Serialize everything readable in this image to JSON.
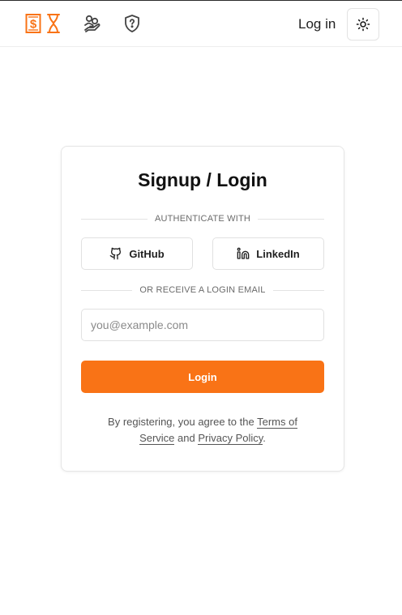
{
  "header": {
    "logo_icon": "dollar-hourglass-icon",
    "nav_icons": [
      "hand-coins-icon",
      "shield-question-icon"
    ],
    "login_label": "Log in",
    "theme_icon": "sun-icon"
  },
  "card": {
    "title": "Signup / Login",
    "auth_divider": "AUTHENTICATE WITH",
    "github_label": "GitHub",
    "linkedin_label": "LinkedIn",
    "email_divider": "OR RECEIVE A LOGIN EMAIL",
    "email_placeholder": "you@example.com",
    "email_value": "",
    "login_button": "Login",
    "terms_prefix": "By registering, you agree to the ",
    "terms_link": "Terms of Service",
    "terms_and": " and ",
    "privacy_link": "Privacy Policy",
    "terms_suffix": "."
  },
  "colors": {
    "accent": "#f97316",
    "logo": "#f97316",
    "border": "#e3e3e3",
    "muted_text": "#6b6b6b"
  }
}
